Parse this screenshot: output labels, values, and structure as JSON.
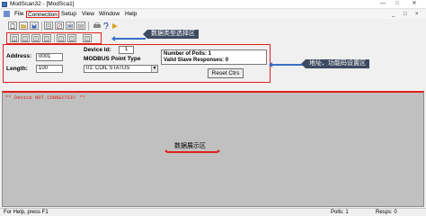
{
  "window": {
    "title": "ModScan32 - [ModSca1]",
    "controls": [
      "—",
      "□",
      "✕"
    ]
  },
  "menu": {
    "items": [
      "File",
      "Connection",
      "Setup",
      "View",
      "Window",
      "Help"
    ],
    "highlighted": "Connection",
    "mdi_controls": [
      "_",
      "□",
      "×"
    ]
  },
  "toolbar": {
    "buttons": [
      "new-icon",
      "open-icon",
      "save-icon",
      "read-icon",
      "write-icon",
      "connect-icon",
      "disconnect-icon",
      "print-icon",
      "help-icon",
      "about-icon"
    ],
    "type_buttons": [
      "coil-type-icon",
      "input-type-icon",
      "register-type-icon",
      "holding-type-icon",
      "decimal-type-icon",
      "hex-type-icon",
      "float-type-icon"
    ]
  },
  "annotations": {
    "type_select": "数据类型选择区",
    "address_setup": "地址、功能码设置区",
    "display": "数据展示区"
  },
  "config": {
    "address_label": "Address:",
    "address_value": "0001",
    "length_label": "Length:",
    "length_value": "100",
    "device_id_label": "Device Id:",
    "device_id_value": "1",
    "point_type_label": "MODBUS Point Type",
    "point_type_value": "01: COIL STATUS",
    "polls_label": "Number of Polls: 1",
    "responses_label": "Valid Slave Responses: 0",
    "reset_button": "Reset Ctrs"
  },
  "display": {
    "status_message": "** Device NOT CONNECTED! **"
  },
  "statusbar": {
    "help": "For Help, press F1",
    "polls": "Polls: 1",
    "resps": "Resps: 0"
  },
  "colors": {
    "highlight_red": "#e0201b",
    "callout_bg": "#3d4a61",
    "arrow_blue": "#3a6fc9",
    "display_bg": "#c0c0c0"
  }
}
